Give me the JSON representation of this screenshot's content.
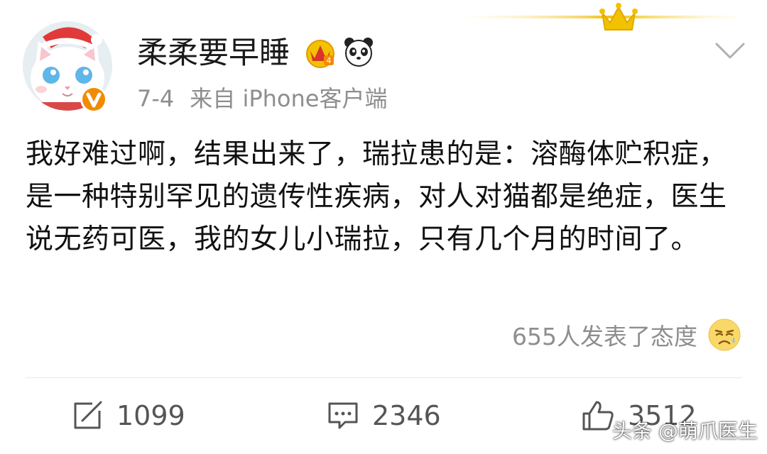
{
  "post": {
    "username": "柔柔要早睡",
    "date": "7-4",
    "source": "来自 iPhone客户端",
    "body": "我好难过啊，结果出来了，瑞拉患的是：溶酶体贮积症，是一种特别罕见的遗传性疾病，对人对猫都是绝症，医生说无药可医，我的女儿小瑞拉，只有几个月的时间了。",
    "reactions_text": "655人发表了态度",
    "reaction_icon": "sad-face-icon"
  },
  "actions": {
    "repost_count": "1099",
    "comment_count": "2346",
    "like_count": "3512"
  },
  "watermark": "头条 @萌爪医生",
  "colors": {
    "gold": "#f2c200",
    "badge_orange": "#f28b00",
    "text_gray": "#8e8e8e",
    "text_dark": "#111111"
  }
}
